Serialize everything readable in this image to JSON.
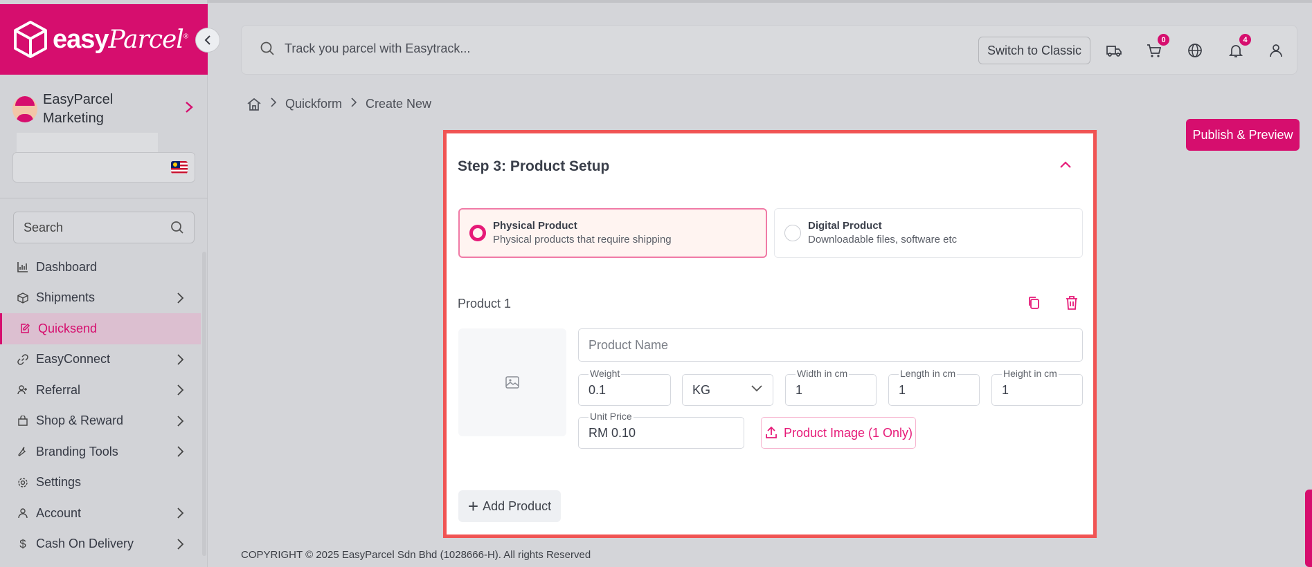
{
  "brand": {
    "name": "easy",
    "name_italic": "Parcel",
    "registered": "®",
    "accent": "#d60e6e"
  },
  "profile": {
    "name": "EasyParcel Marketing"
  },
  "sidebar": {
    "search_label": "Search",
    "items": [
      {
        "label": "Dashboard",
        "icon": "chart-icon",
        "has_children": false
      },
      {
        "label": "Shipments",
        "icon": "box-icon",
        "has_children": true
      },
      {
        "label": "Quicksend",
        "icon": "edit-icon",
        "has_children": false,
        "active": true
      },
      {
        "label": "EasyConnect",
        "icon": "link-icon",
        "has_children": true
      },
      {
        "label": "Referral",
        "icon": "user-plus-icon",
        "has_children": true
      },
      {
        "label": "Shop & Reward",
        "icon": "bag-icon",
        "has_children": true
      },
      {
        "label": "Branding Tools",
        "icon": "wrench-icon",
        "has_children": true
      },
      {
        "label": "Settings",
        "icon": "gear-icon",
        "has_children": false
      },
      {
        "label": "Account",
        "icon": "user-icon",
        "has_children": true
      },
      {
        "label": "Cash On Delivery",
        "icon": "dollar-icon",
        "has_children": true
      }
    ]
  },
  "topbar": {
    "track_placeholder": "Track you parcel with Easytrack...",
    "switch_label": "Switch to Classic",
    "cart_count": "0",
    "notification_count": "4"
  },
  "breadcrumb": {
    "items": [
      "Quickform",
      "Create New"
    ]
  },
  "publish_label": "Publish & Preview",
  "card": {
    "title": "Step 3: Product Setup",
    "product_types": [
      {
        "title": "Physical Product",
        "desc": "Physical products that require shipping",
        "selected": true
      },
      {
        "title": "Digital Product",
        "desc": "Downloadable files, software etc",
        "selected": false
      }
    ],
    "product_label": "Product 1",
    "fields": {
      "name_placeholder": "Product Name",
      "weight_label": "Weight",
      "weight_value": "0.1",
      "unit_value": "KG",
      "width_label": "Width in cm",
      "width_value": "1",
      "length_label": "Length in cm",
      "length_value": "1",
      "height_label": "Height in cm",
      "height_value": "1",
      "price_label": "Unit Price",
      "price_value": "RM 0.10"
    },
    "upload_label": "Product Image (1 Only)",
    "add_product_label": "Add Product"
  },
  "footer": "COPYRIGHT © 2025 EasyParcel Sdn Bhd (1028666-H). All rights Reserved"
}
